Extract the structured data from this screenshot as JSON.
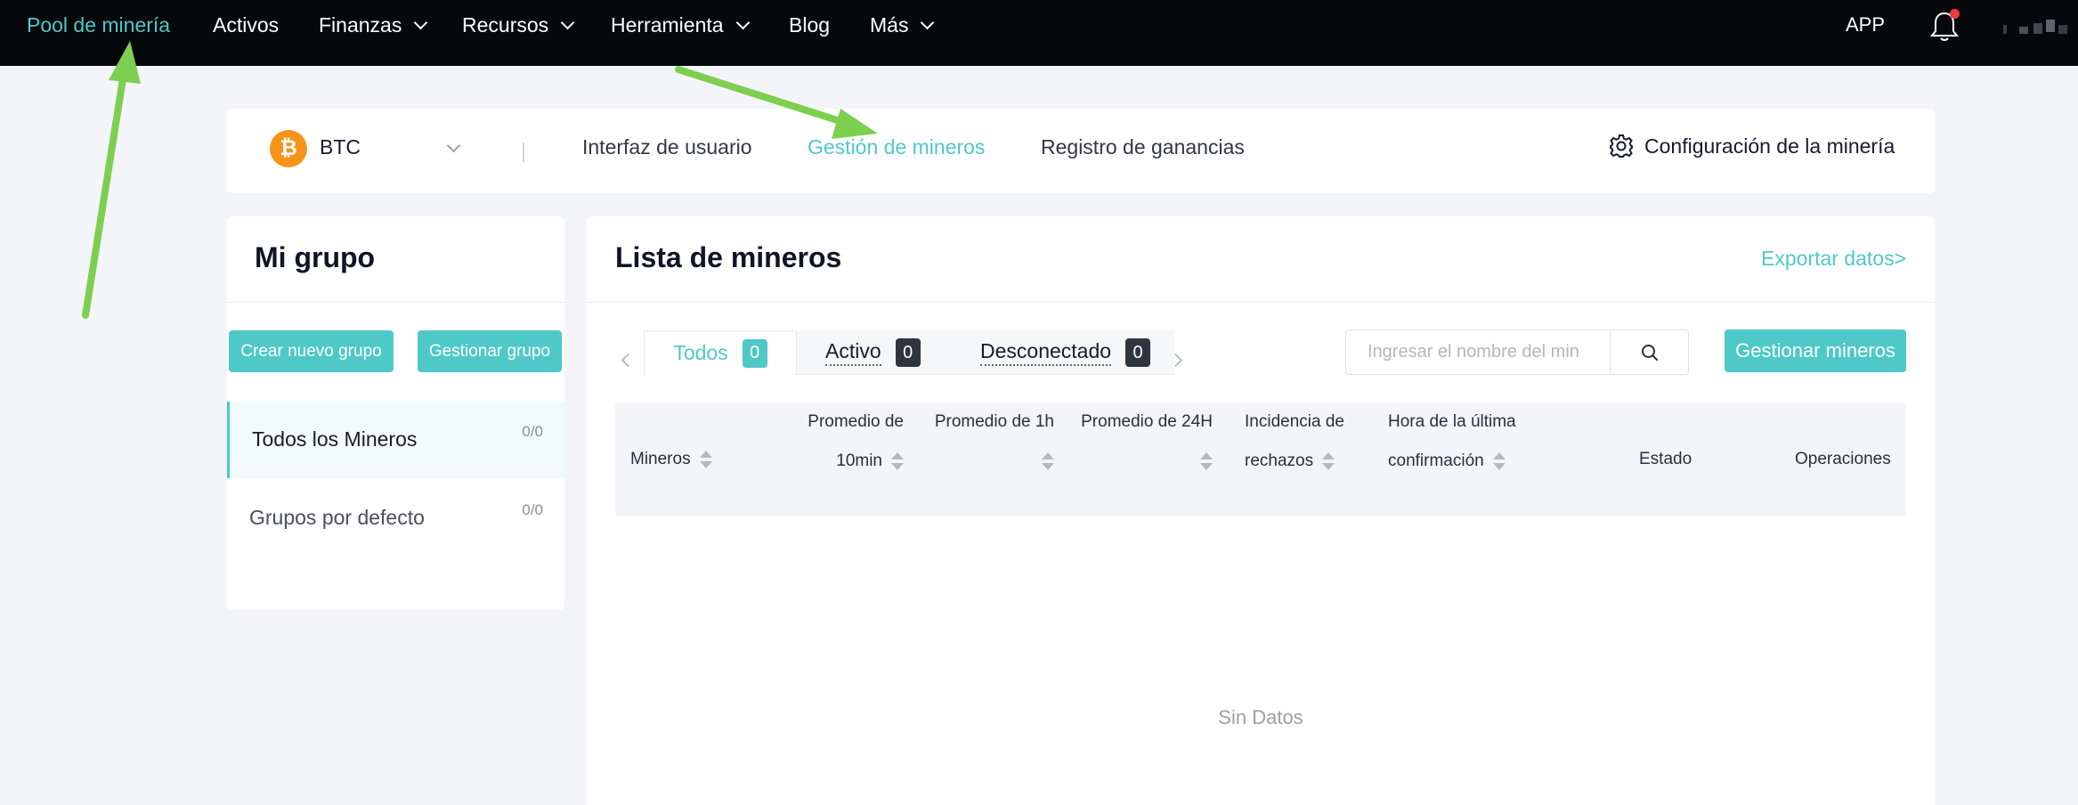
{
  "nav": {
    "items": [
      {
        "label": "Pool de minería",
        "active": true,
        "dropdown": false
      },
      {
        "label": "Activos",
        "active": false,
        "dropdown": false
      },
      {
        "label": "Finanzas",
        "active": false,
        "dropdown": true
      },
      {
        "label": "Recursos",
        "active": false,
        "dropdown": true
      },
      {
        "label": "Herramienta",
        "active": false,
        "dropdown": true
      },
      {
        "label": "Blog",
        "active": false,
        "dropdown": false
      },
      {
        "label": "Más",
        "active": false,
        "dropdown": true
      }
    ],
    "app_label": "APP",
    "bell_has_notification": true
  },
  "coinbar": {
    "coin_symbol": "₿",
    "coin": "BTC",
    "tabs": [
      {
        "label": "Interfaz de usuario",
        "active": false
      },
      {
        "label": "Gestión de mineros",
        "active": true
      },
      {
        "label": "Registro de ganancias",
        "active": false
      }
    ],
    "settings_label": "Configuración de la minería"
  },
  "groups": {
    "title": "Mi grupo",
    "create_button": "Crear nuevo grupo",
    "manage_button": "Gestionar grupo",
    "items": [
      {
        "label": "Todos los Mineros",
        "count": "0/0",
        "selected": true
      },
      {
        "label": "Grupos por defecto",
        "count": "0/0",
        "selected": false
      }
    ]
  },
  "miners": {
    "title": "Lista de mineros",
    "export_label": "Exportar datos>",
    "filters": [
      {
        "label": "Todos",
        "count": "0",
        "active": true
      },
      {
        "label": "Activo",
        "count": "0",
        "active": false
      },
      {
        "label": "Desconectado",
        "count": "0",
        "active": false
      }
    ],
    "search_placeholder": "Ingresar el nombre del min",
    "manage_button": "Gestionar mineros",
    "columns": {
      "miners": "Mineros",
      "avg10_line1": "Promedio de",
      "avg10_line2": "10min",
      "avg1h": "Promedio de 1h",
      "avg24h": "Promedio de 24H",
      "reject_line1": "Incidencia de",
      "reject_line2": "rechazos",
      "last_line1": "Hora de la última",
      "last_line2": "confirmación",
      "status": "Estado",
      "operations": "Operaciones"
    },
    "empty_text": "Sin Datos"
  },
  "colors": {
    "accent": "#4fc8c8",
    "nav_bg": "#06080c",
    "bitcoin": "#f7931a",
    "annotation_arrow": "#7ccf4f",
    "notification_dot": "#f03a3a"
  }
}
